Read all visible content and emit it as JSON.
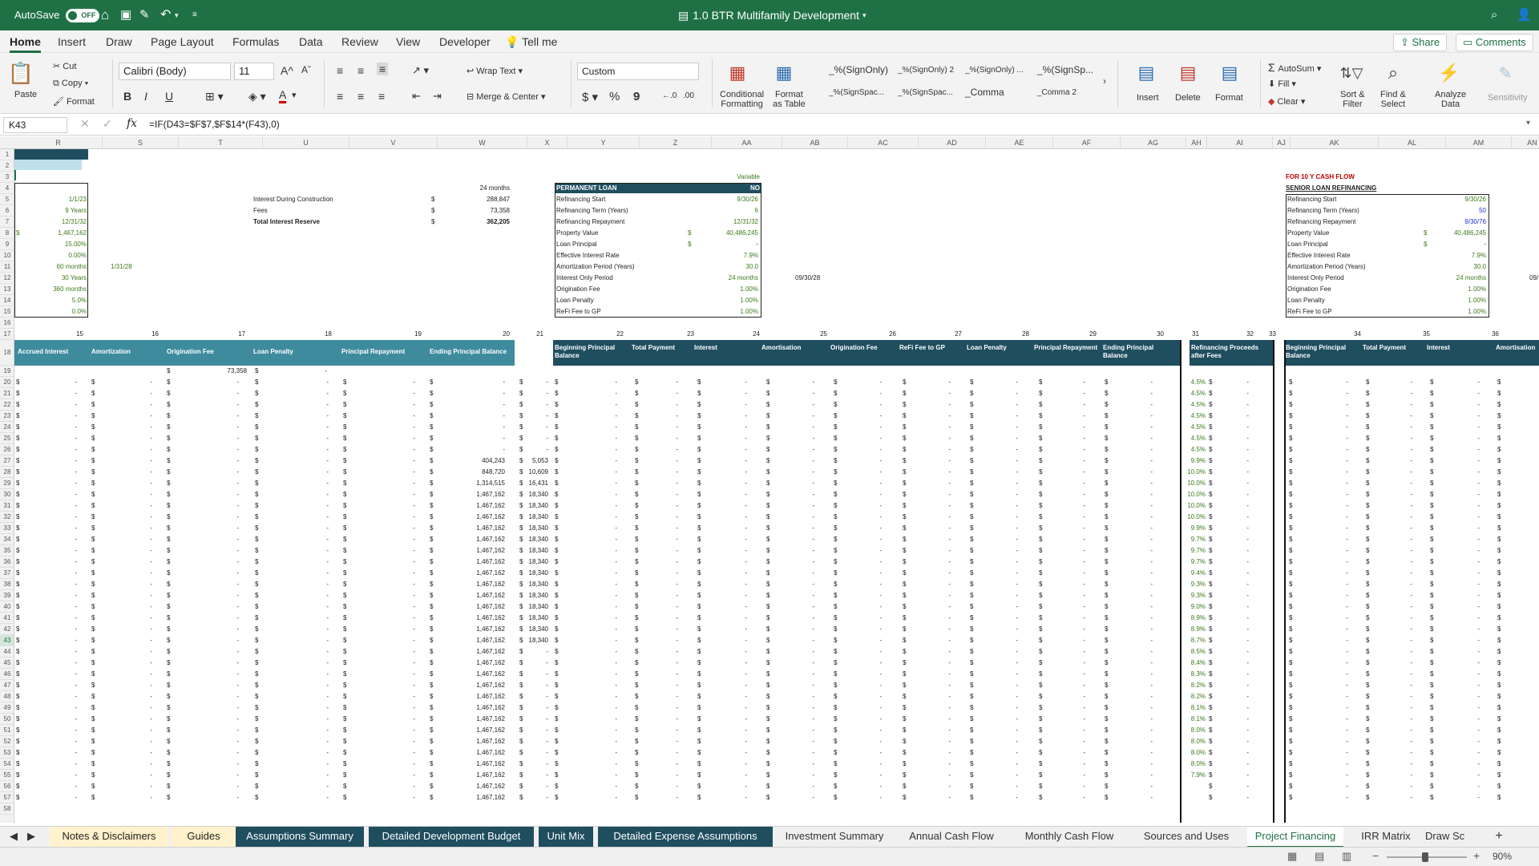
{
  "titlebar": {
    "autosave": "AutoSave",
    "toggle": "OFF",
    "title": "1.0 BTR Multifamily Development"
  },
  "menu": {
    "tabs": [
      "Home",
      "Insert",
      "Draw",
      "Page Layout",
      "Formulas",
      "Data",
      "Review",
      "View",
      "Developer"
    ],
    "tell_me": "Tell me",
    "share": "Share",
    "comments": "Comments"
  },
  "ribbon": {
    "paste": "Paste",
    "cut": "Cut",
    "copy": "Copy",
    "format": "Format",
    "font_name": "Calibri (Body)",
    "font_size": "11",
    "bold": "B",
    "italic": "I",
    "underline": "U",
    "wrap_text": "Wrap Text",
    "merge_center": "Merge & Center",
    "number_format": "Custom",
    "currency": "$",
    "percent": "%",
    "comma": "9",
    "cond_format": [
      "Conditional",
      "Formatting"
    ],
    "format_table": [
      "Format",
      "as Table"
    ],
    "styles": [
      "_%(SignOnly)",
      "_%(SignOnly) 2",
      "_%(SignOnly) ...",
      "_%(SignSp...",
      "_%(SignSpac...",
      "_%(SignSpac...",
      "_Comma",
      "_Comma 2"
    ],
    "insert": "Insert",
    "delete": "Delete",
    "format_cells": "Format",
    "autosum": "AutoSum",
    "fill": "Fill",
    "clear": "Clear",
    "sort_filter": [
      "Sort &",
      "Filter"
    ],
    "find_select": [
      "Find &",
      "Select"
    ],
    "analyze": [
      "Analyze",
      "Data"
    ],
    "sensitivity": "Sensitivity"
  },
  "formula_bar": {
    "cell_ref": "K43",
    "fx": "fx",
    "formula": "=IF(D43=$F$7,$F$14*(F43),0)"
  },
  "columns": [
    "R",
    "S",
    "T",
    "U",
    "V",
    "W",
    "X",
    "Y",
    "Z",
    "AA",
    "AB",
    "AC",
    "AD",
    "AE",
    "AF",
    "AG",
    "AH",
    "AI",
    "AJ",
    "AK",
    "AL",
    "AM",
    "AN"
  ],
  "rows": [
    "1",
    "2",
    "3",
    "4",
    "5",
    "6",
    "7",
    "8",
    "9",
    "10",
    "11",
    "12",
    "13",
    "14",
    "15",
    "16",
    "17",
    "18",
    "19",
    "20",
    "21",
    "22",
    "23",
    "24",
    "25",
    "26",
    "27",
    "28",
    "29",
    "30",
    "31",
    "32",
    "33",
    "34",
    "35",
    "36",
    "37",
    "38",
    "39",
    "40",
    "41",
    "42",
    "43",
    "44",
    "45",
    "46",
    "47",
    "48",
    "49",
    "50",
    "51",
    "52",
    "53",
    "54",
    "55",
    "56",
    "57",
    "58"
  ],
  "top_left": {
    "r_values": [
      "1/1/23",
      "9 Years",
      "12/31/32",
      "1,467,162",
      "15.00%",
      "0.00%",
      "60 months",
      "30 Years",
      "360 months",
      "5.0%",
      "0.0%"
    ],
    "r8_dollar": "$",
    "s11": "1/31/28",
    "interest": {
      "labels": [
        "Interest During Construction",
        "Fees",
        "Total Interest Reserve"
      ],
      "dollar": "$",
      "values": [
        "288,847",
        "73,358",
        "362,205"
      ],
      "months": "24 months"
    }
  },
  "permanent_loan": {
    "variable": "Variable",
    "title": "PERMANENT LOAN",
    "flag": "NO",
    "labels": [
      "Refinancing Start",
      "Refinancing Term (Years)",
      "Refinancing Repayment",
      "Property Value",
      "Loan Principal",
      "Effective Interest Rate",
      "Amortization Period (Years)",
      "Interest Only Period",
      "Origination Fee",
      "Loan Penalty",
      "ReFi Fee to GP"
    ],
    "values": [
      "9/30/26",
      "6",
      "12/31/32",
      "40,486,245",
      "-",
      "7.9%",
      "30.0",
      "24 months",
      "1.00%",
      "1.00%",
      "1.00%"
    ],
    "dollar": "$",
    "ab12": "09/30/28"
  },
  "senior_loan": {
    "note": "FOR 10 Y CASH FLOW",
    "title": "SENIOR LOAN REFINANCING",
    "labels": [
      "Refinancing Start",
      "Refinancing Term (Years)",
      "Refinancing Repayment",
      "Property Value",
      "Loan Principal",
      "Effective Interest Rate",
      "Amortization Period (Years)",
      "Interest Only Period",
      "Origination Fee",
      "Loan Penalty",
      "ReFi Fee to GP"
    ],
    "values": [
      "9/30/26",
      "50",
      "9/30/76",
      "40,486,245",
      "-",
      "7.9%",
      "30.0",
      "24 months",
      "1.00%",
      "1.00%",
      "1.00%"
    ],
    "dollar": "$",
    "an12": "09/"
  },
  "index_row": [
    "15",
    "16",
    "17",
    "18",
    "19",
    "20",
    "21",
    "22",
    "23",
    "24",
    "25",
    "26",
    "27",
    "28",
    "29",
    "30",
    "31",
    "32",
    "33",
    "34",
    "35",
    "36"
  ],
  "headers_left": [
    "Accrued Interest",
    "Amortization",
    "Origination Fee",
    "Loan Penalty",
    "Principal Repayment",
    "Ending Principal Balance"
  ],
  "headers_mid": [
    "Beginning Principal Balance",
    "Total Payment",
    "Interest",
    "Amortisation",
    "Origination Fee",
    "ReFi Fee to GP",
    "Loan Penalty",
    "Principal Repayment",
    "Ending Principal Balance"
  ],
  "header_refi": "Refinancing Proceeds after Fees",
  "headers_right": [
    "Beginning Principal Balance",
    "Total Payment",
    "Interest",
    "Amortisation"
  ],
  "row19": {
    "t": "73,358",
    "dash": "-"
  },
  "dollar": "$",
  "dash": "-",
  "w_values": [
    "-",
    "-",
    "-",
    "-",
    "-",
    "-",
    "-",
    "404,243",
    "848,720",
    "1,314,515",
    "1,467,162",
    "1,467,162",
    "1,467,162",
    "1,467,162",
    "1,467,162",
    "1,467,162",
    "1,467,162",
    "1,467,162",
    "1,467,162",
    "1,467,162",
    "1,467,162",
    "1,467,162",
    "1,467,162",
    "1,467,162",
    "1,467,162",
    "1,467,162",
    "1,467,162",
    "1,467,162",
    "1,467,162",
    "1,467,162",
    "1,467,162",
    "1,467,162",
    "1,467,162",
    "1,467,162",
    "1,467,162",
    "1,467,162",
    "1,467,162",
    "1,467,162"
  ],
  "x_values": [
    "-",
    "-",
    "-",
    "-",
    "-",
    "-",
    "-",
    "5,053",
    "10,609",
    "16,431",
    "18,340",
    "18,340",
    "18,340",
    "18,340",
    "18,340",
    "18,340",
    "18,340",
    "18,340",
    "18,340",
    "18,340",
    "18,340",
    "18,340",
    "18,340",
    "18,340",
    "-",
    "-",
    "-",
    "-",
    "-",
    "-",
    "-",
    "-",
    "-",
    "-",
    "-",
    "-",
    "-",
    "-"
  ],
  "ah_values": [
    "4.5%",
    "4.5%",
    "4.5%",
    "4.5%",
    "4.5%",
    "4.5%",
    "4.5%",
    "9.9%",
    "10.0%",
    "10.0%",
    "10.0%",
    "10.0%",
    "10.0%",
    "9.9%",
    "9.7%",
    "9.7%",
    "9.7%",
    "9.4%",
    "9.3%",
    "9.3%",
    "9.0%",
    "8.9%",
    "8.9%",
    "8.7%",
    "8.5%",
    "8.4%",
    "8.3%",
    "8.2%",
    "8.2%",
    "8.1%",
    "8.1%",
    "8.0%",
    "8.0%",
    "8.0%",
    "8.0%",
    "7.9%"
  ],
  "sheet_tabs": [
    "Notes & Disclaimers",
    "Guides",
    "Assumptions Summary",
    "Detailed Development Budget",
    "Unit Mix",
    "Detailed Expense Assumptions",
    "Investment Summary",
    "Annual Cash Flow",
    "Monthly Cash Flow",
    "Sources and Uses",
    "Project Financing",
    "IRR Matrix",
    "Draw Sch"
  ],
  "status": {
    "zoom": "90%"
  }
}
